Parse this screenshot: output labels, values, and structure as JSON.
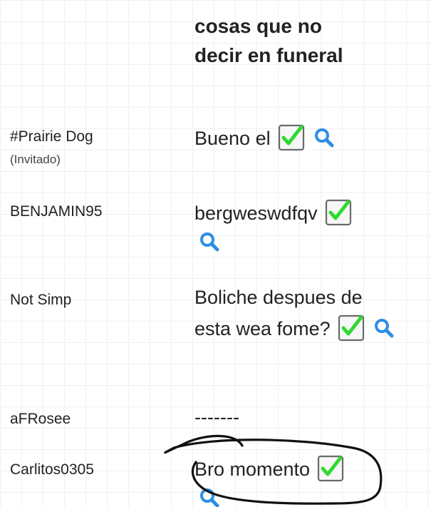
{
  "header": {
    "title": "cosas que no decir en funeral"
  },
  "rows": [
    {
      "name": "#Prairie Dog",
      "sub": "(Invitado)",
      "answer": "Bueno el"
    },
    {
      "name": "BENJAMIN95",
      "answer": "bergweswdfqv"
    },
    {
      "name": "Not Simp",
      "answer": "Boliche despues de esta wea fome?"
    },
    {
      "name": "aFRosee",
      "answer": "-------"
    },
    {
      "name": "Carlitos0305",
      "answer": "Bro momento"
    }
  ],
  "icons": {
    "check": "check-icon",
    "search": "search-icon"
  },
  "colors": {
    "check_green": "#2fd92f",
    "search_blue": "#2e8ee6",
    "grid": "#eef0f3"
  }
}
